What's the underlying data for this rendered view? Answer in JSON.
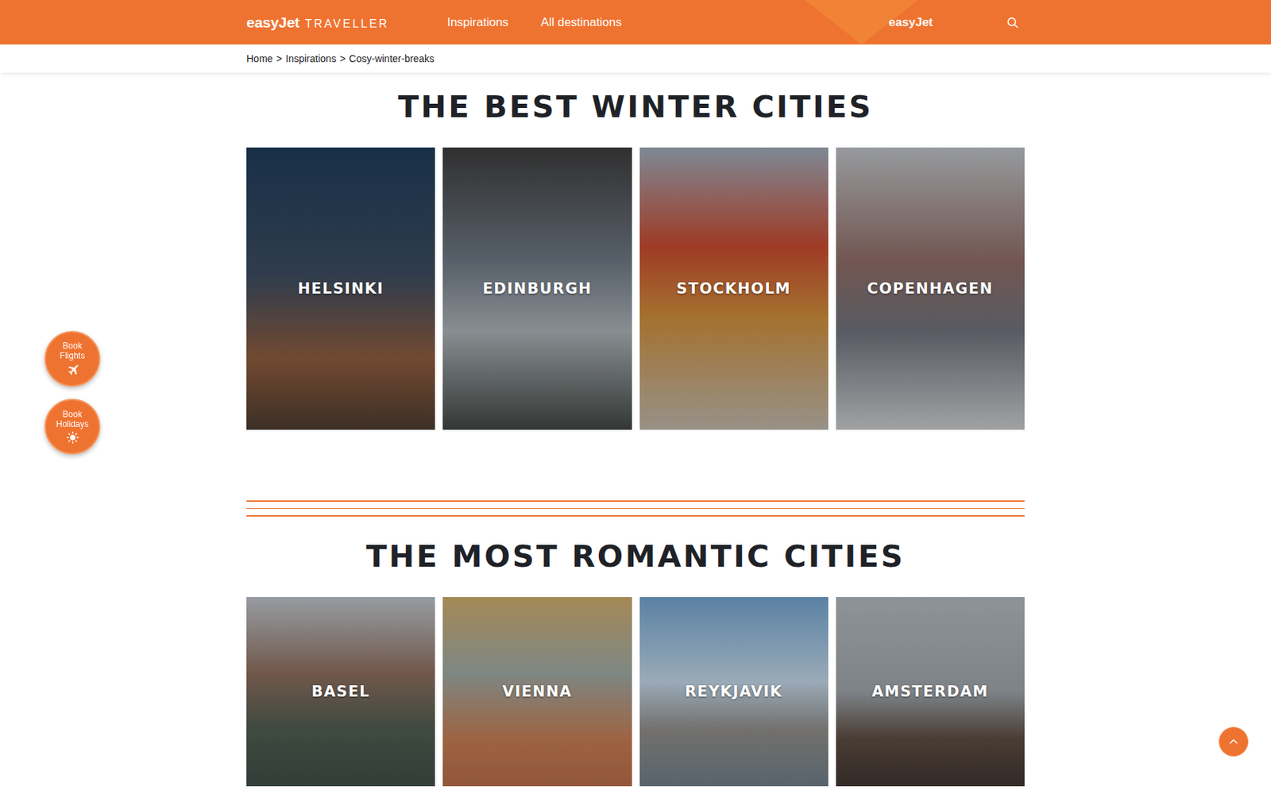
{
  "header": {
    "logo": {
      "brand": "easyJet",
      "product": "TRAVELLER"
    },
    "nav": [
      {
        "label": "Inspirations"
      },
      {
        "label": "All destinations"
      }
    ],
    "brand_link": "easyJet"
  },
  "breadcrumb": {
    "separator": ">",
    "items": [
      "Home",
      "Inspirations",
      "Cosy-winter-breaks"
    ]
  },
  "sections": [
    {
      "title": "THE BEST WINTER CITIES",
      "kind": "tall",
      "cities": [
        "HELSINKI",
        "EDINBURGH",
        "STOCKHOLM",
        "COPENHAGEN"
      ]
    },
    {
      "title": "THE MOST ROMANTIC CITIES",
      "kind": "square",
      "cities": [
        "BASEL",
        "VIENNA",
        "REYKJAVIK",
        "AMSTERDAM"
      ]
    }
  ],
  "floating_buttons": [
    {
      "lines": [
        "Book",
        "Flights"
      ],
      "icon": "plane"
    },
    {
      "lines": [
        "Book",
        "Holidays"
      ],
      "icon": "sun"
    }
  ]
}
